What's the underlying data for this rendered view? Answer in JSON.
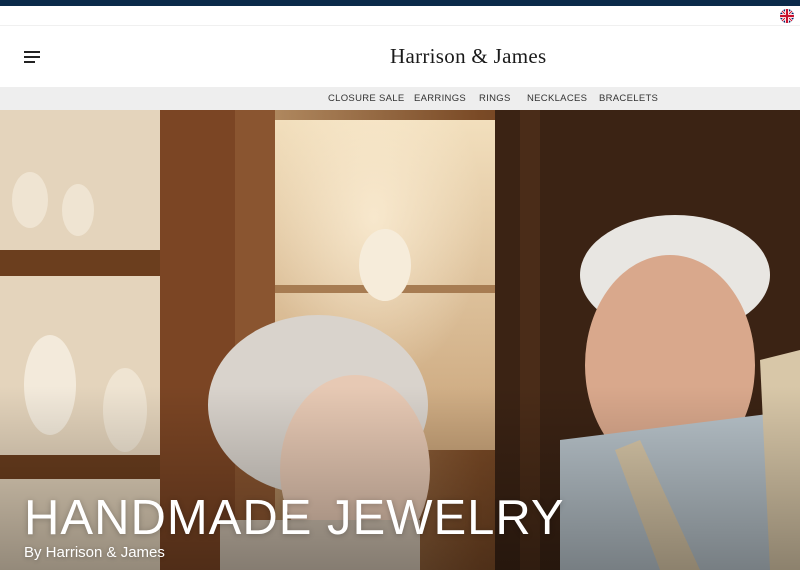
{
  "colors": {
    "topbar": "#0b2a4a",
    "nav_bg": "#eeeeee",
    "hero_text": "#ffffff"
  },
  "utility": {
    "language_icon": "uk-flag-icon"
  },
  "header": {
    "menu_icon": "hamburger-menu-icon",
    "logo": "Harrison & James"
  },
  "nav": {
    "items": [
      {
        "label": "CLOSURE SALE"
      },
      {
        "label": "EARRINGS"
      },
      {
        "label": "RINGS"
      },
      {
        "label": "NECKLACES"
      },
      {
        "label": "BRACELETS"
      }
    ]
  },
  "hero": {
    "title": "HANDMADE JEWELRY",
    "subtitle": "By Harrison & James"
  }
}
